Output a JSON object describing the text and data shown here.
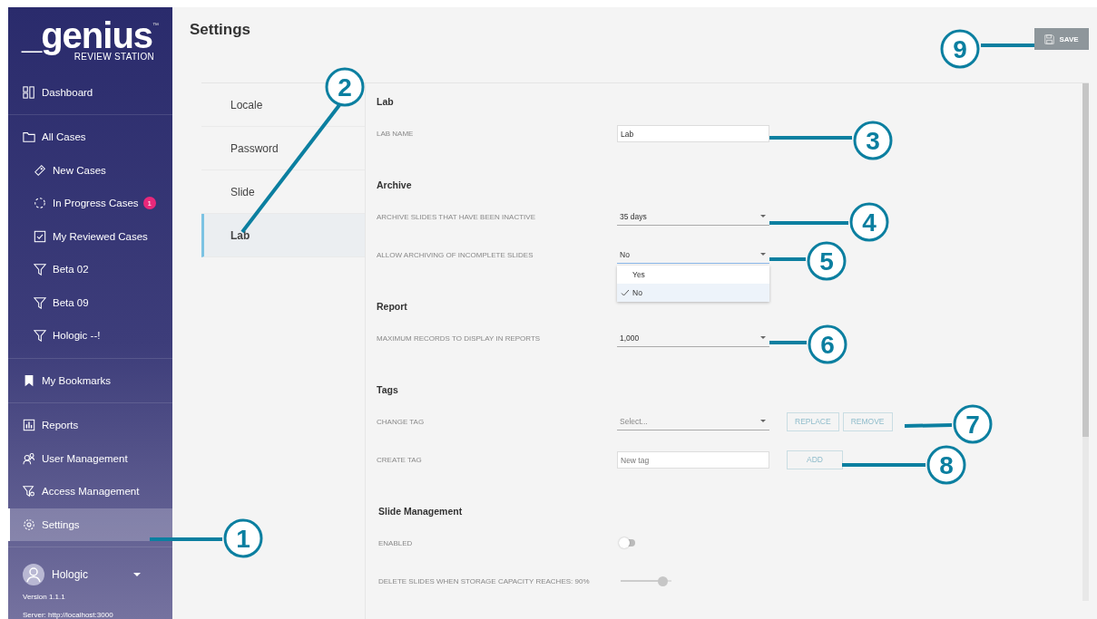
{
  "sidebar": {
    "logo": {
      "name": "_genius",
      "mark": "™",
      "subtitle": "REVIEW STATION"
    },
    "groups": [
      {
        "items": [
          {
            "label": "Dashboard",
            "selected": false
          }
        ]
      },
      {
        "items": [
          {
            "label": "All Cases",
            "selected": false,
            "children": [
              {
                "label": "New Cases",
                "selected": false
              },
              {
                "label": "In Progress Cases",
                "selected": false,
                "badge": "1"
              },
              {
                "label": "My Reviewed Cases",
                "selected": false
              },
              {
                "label": "Beta 02",
                "selected": false
              },
              {
                "label": "Beta 09",
                "selected": false
              },
              {
                "label": "Hologic --!",
                "selected": false
              }
            ]
          }
        ]
      },
      {
        "items": [
          {
            "label": "My Bookmarks",
            "selected": false
          }
        ]
      },
      {
        "items": [
          {
            "label": "Reports",
            "selected": false
          },
          {
            "label": "User Management",
            "selected": false
          },
          {
            "label": "Access Management",
            "selected": false
          },
          {
            "label": "Settings",
            "selected": true
          }
        ]
      }
    ],
    "user": {
      "name": "Hologic",
      "version": "Version 1.1.1",
      "server": "Server: http://localhost:3000"
    }
  },
  "page": {
    "title": "Settings",
    "save_button": {
      "label": "SAVE",
      "disabled": true
    }
  },
  "settings_nav": [
    {
      "label": "Locale",
      "selected": false
    },
    {
      "label": "Password",
      "selected": false
    },
    {
      "label": "Slide",
      "selected": false
    },
    {
      "label": "Lab",
      "selected": true
    }
  ],
  "sections": [
    {
      "title": "Lab",
      "rows": [
        {
          "kind": "text",
          "label": "LAB NAME",
          "value": "Lab"
        }
      ]
    },
    {
      "title": "Archive",
      "rows": [
        {
          "kind": "select",
          "label": "ARCHIVE SLIDES THAT HAVE BEEN INACTIVE",
          "value": "35 days",
          "open": false
        },
        {
          "kind": "select",
          "label": "ALLOW ARCHIVING OF INCOMPLETE SLIDES",
          "value": "No",
          "open": true,
          "options": [
            {
              "label": "Yes",
              "selected": false
            },
            {
              "label": "No",
              "selected": true
            }
          ]
        }
      ]
    },
    {
      "title": "Report",
      "rows": [
        {
          "kind": "select",
          "label": "MAXIMUM RECORDS TO DISPLAY IN REPORTS",
          "value": "1,000",
          "open": false
        }
      ]
    },
    {
      "title": "Tags",
      "rows": [
        {
          "kind": "select",
          "label": "CHANGE TAG",
          "placeholder": "Select...",
          "open": false,
          "buttons": [
            {
              "label": "REPLACE",
              "disabled": true
            },
            {
              "label": "REMOVE",
              "disabled": true
            }
          ]
        },
        {
          "kind": "text",
          "label": "CREATE TAG",
          "placeholder": "New tag",
          "buttons": [
            {
              "label": "ADD",
              "disabled": true
            }
          ]
        }
      ]
    },
    {
      "title": "Slide Management",
      "rows": [
        {
          "kind": "toggle",
          "label": "ENABLED",
          "on": false
        },
        {
          "kind": "slider",
          "label": "DELETE SLIDES WHEN STORAGE CAPACITY REACHES: 90%",
          "level": 0.9
        }
      ]
    }
  ],
  "callouts": [
    {
      "number": "1"
    },
    {
      "number": "2"
    },
    {
      "number": "3"
    },
    {
      "number": "4"
    },
    {
      "number": "5"
    },
    {
      "number": "6"
    },
    {
      "number": "7"
    },
    {
      "number": "8"
    },
    {
      "number": "9"
    }
  ]
}
